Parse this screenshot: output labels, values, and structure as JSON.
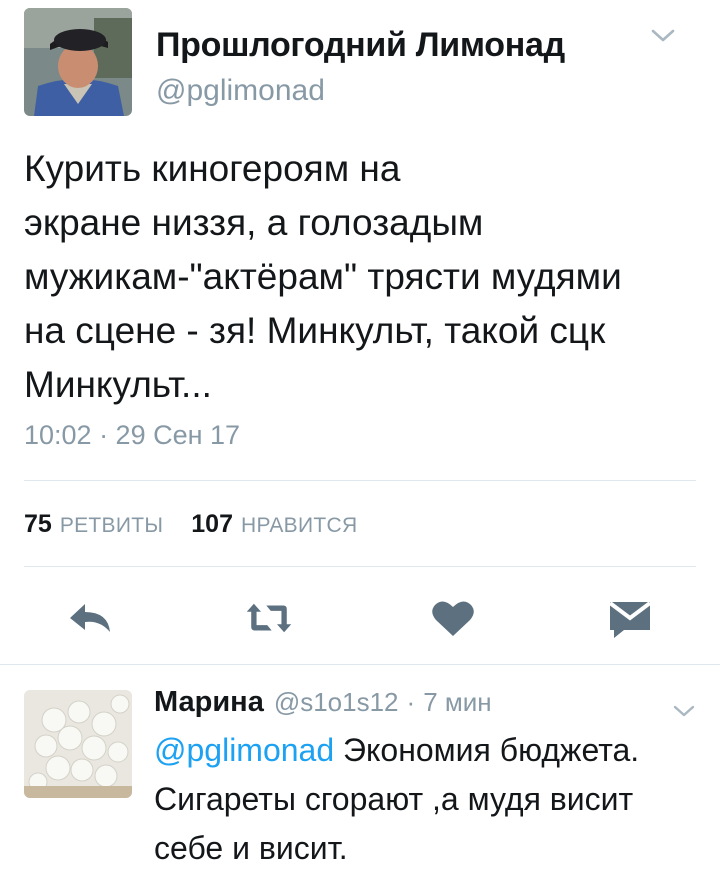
{
  "tweet": {
    "author_name": "Прошлогодний Лимонад",
    "author_handle": "@pglimonad",
    "text": "Курить киногероям на\nэкране низзя, а голозадым\nмужикам-\"актёрам\" трясти мудями\nна сцене - зя! Минкульт, такой сцк\nМинкульт...",
    "timestamp": "10:02 · 29 Сен 17",
    "retweets_count": "75",
    "retweets_label": "РЕТВИТЫ",
    "likes_count": "107",
    "likes_label": "НРАВИТСЯ"
  },
  "actions": [
    {
      "icon": "reply-icon"
    },
    {
      "icon": "retweet-icon"
    },
    {
      "icon": "heart-icon"
    },
    {
      "icon": "direct-message-icon"
    }
  ],
  "reply": {
    "author_name": "Марина",
    "author_handle": "@s1o1s12",
    "separator": "·",
    "time": "7 мин",
    "mention": "@pglimonad",
    "text": " Экономия бюджета. Сигареты сгорают ,а мудя висит себе и висит."
  },
  "colors": {
    "text_primary": "#14171a",
    "text_secondary": "#8899a6",
    "link": "#1da1f2",
    "icon": "#5c7080",
    "divider": "#e1e8ed"
  }
}
